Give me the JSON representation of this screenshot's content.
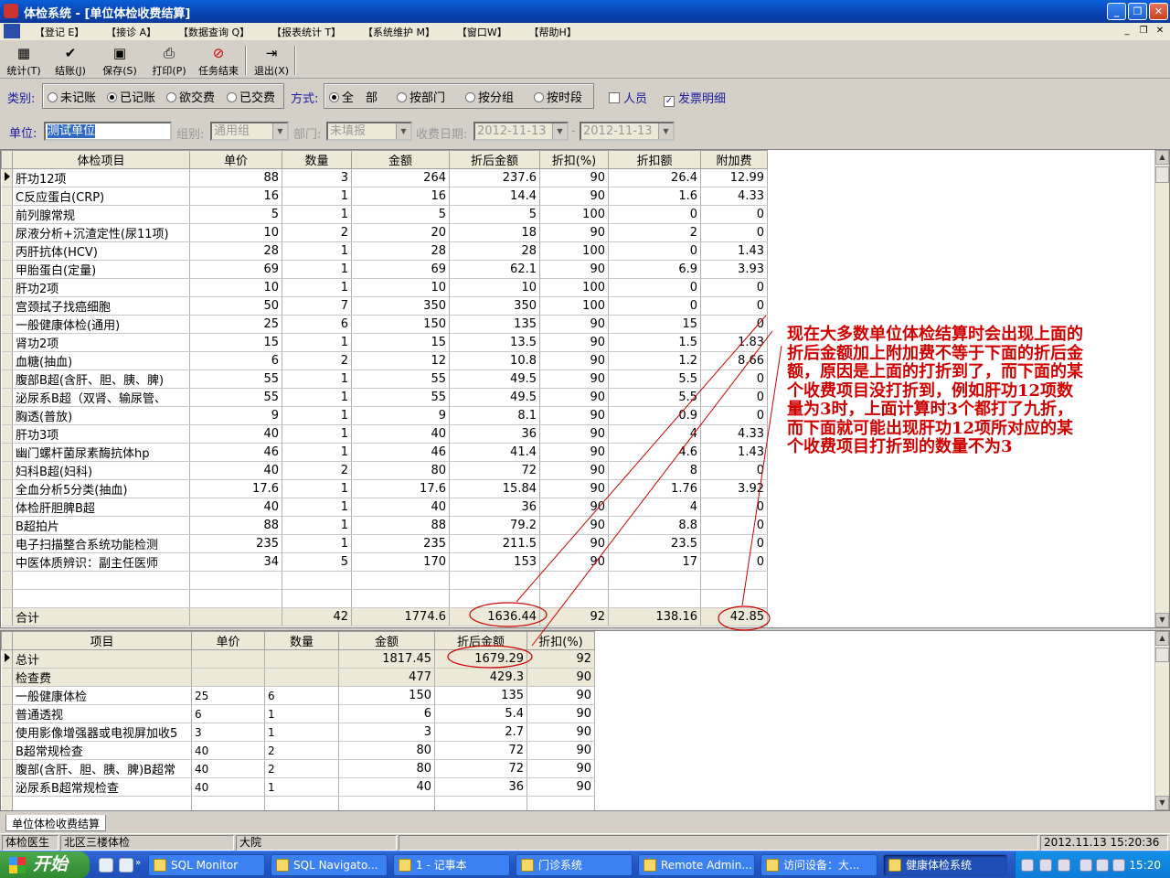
{
  "window": {
    "title": "体检系统 - [单位体检收费结算]"
  },
  "menu": [
    "【登记 E】",
    "【接诊 A】",
    "【数据查询 Q】",
    "【报表统计 T】",
    "【系统维护 M】",
    "【窗口W】",
    "【帮助H】"
  ],
  "toolbar": [
    {
      "label": "统计(T)",
      "icon": "stats-icon"
    },
    {
      "label": "结账(J)",
      "icon": "checkout-icon"
    },
    {
      "label": "保存(S)",
      "icon": "save-icon"
    },
    {
      "label": "打印(P)",
      "icon": "print-icon"
    },
    {
      "label": "任务结束",
      "icon": "stop-icon"
    },
    {
      "label": "退出(X)",
      "icon": "exit-icon"
    }
  ],
  "filters": {
    "category_label": "类别:",
    "categories": [
      {
        "label": "未记账",
        "checked": false
      },
      {
        "label": "已记账",
        "checked": true
      },
      {
        "label": "欲交费",
        "checked": false
      },
      {
        "label": "已交费",
        "checked": false
      }
    ],
    "mode_label": "方式:",
    "modes": [
      {
        "label": "全　部",
        "checked": true
      },
      {
        "label": "按部门",
        "checked": false
      },
      {
        "label": "按分组",
        "checked": false
      },
      {
        "label": "按时段",
        "checked": false
      }
    ],
    "person": {
      "label": "人员",
      "checked": false
    },
    "invoice": {
      "label": "发票明细",
      "checked": true
    }
  },
  "unitbar": {
    "unit_label": "单位:",
    "unit_value": "测试单位",
    "group_label": "组别:",
    "group_value": "通用组",
    "dept_label": "部门:",
    "dept_value": "未填报",
    "date_label": "收费日期:",
    "date_from": "2012-11-13",
    "date_to": "2012-11-13",
    "date_sep": "-"
  },
  "grid1": {
    "headers": [
      "体检项目",
      "单价",
      "数量",
      "金额",
      "折后金额",
      "折扣(%)",
      "折扣额",
      "附加费"
    ],
    "rows": [
      [
        "肝功12项",
        "88",
        "3",
        "264",
        "237.6",
        "90",
        "26.4",
        "12.99"
      ],
      [
        "C反应蛋白(CRP)",
        "16",
        "1",
        "16",
        "14.4",
        "90",
        "1.6",
        "4.33"
      ],
      [
        "前列腺常规",
        "5",
        "1",
        "5",
        "5",
        "100",
        "0",
        "0"
      ],
      [
        "尿液分析+沉渣定性(尿11项)",
        "10",
        "2",
        "20",
        "18",
        "90",
        "2",
        "0"
      ],
      [
        "丙肝抗体(HCV)",
        "28",
        "1",
        "28",
        "28",
        "100",
        "0",
        "1.43"
      ],
      [
        "甲胎蛋白(定量)",
        "69",
        "1",
        "69",
        "62.1",
        "90",
        "6.9",
        "3.93"
      ],
      [
        "肝功2项",
        "10",
        "1",
        "10",
        "10",
        "100",
        "0",
        "0"
      ],
      [
        "宫颈拭子找癌细胞",
        "50",
        "7",
        "350",
        "350",
        "100",
        "0",
        "0"
      ],
      [
        "一般健康体检(通用)",
        "25",
        "6",
        "150",
        "135",
        "90",
        "15",
        "0"
      ],
      [
        "肾功2项",
        "15",
        "1",
        "15",
        "13.5",
        "90",
        "1.5",
        "1.83"
      ],
      [
        "血糖(抽血)",
        "6",
        "2",
        "12",
        "10.8",
        "90",
        "1.2",
        "8.66"
      ],
      [
        "腹部B超(含肝、胆、胰、脾)",
        "55",
        "1",
        "55",
        "49.5",
        "90",
        "5.5",
        "0"
      ],
      [
        "泌尿系B超（双肾、输尿管、",
        "55",
        "1",
        "55",
        "49.5",
        "90",
        "5.5",
        "0"
      ],
      [
        "胸透(普放)",
        "9",
        "1",
        "9",
        "8.1",
        "90",
        "0.9",
        "0"
      ],
      [
        "肝功3项",
        "40",
        "1",
        "40",
        "36",
        "90",
        "4",
        "4.33"
      ],
      [
        "幽门螺杆菌尿素酶抗体hp",
        "46",
        "1",
        "46",
        "41.4",
        "90",
        "4.6",
        "1.43"
      ],
      [
        "妇科B超(妇科)",
        "40",
        "2",
        "80",
        "72",
        "90",
        "8",
        "0"
      ],
      [
        "全血分析5分类(抽血)",
        "17.6",
        "1",
        "17.6",
        "15.84",
        "90",
        "1.76",
        "3.92"
      ],
      [
        "体检肝胆脾B超",
        "40",
        "1",
        "40",
        "36",
        "90",
        "4",
        "0"
      ],
      [
        "B超拍片",
        "88",
        "1",
        "88",
        "79.2",
        "90",
        "8.8",
        "0"
      ],
      [
        "电子扫描整合系统功能检测",
        "235",
        "1",
        "235",
        "211.5",
        "90",
        "23.5",
        "0"
      ],
      [
        "中医体质辨识：副主任医师",
        "34",
        "5",
        "170",
        "153",
        "90",
        "17",
        "0"
      ]
    ],
    "total": [
      "合计",
      "",
      "42",
      "1774.6",
      "1636.44",
      "92",
      "138.16",
      "42.85"
    ]
  },
  "grid2": {
    "headers": [
      "项目",
      "单价",
      "数量",
      "金额",
      "折后金额",
      "折扣(%)"
    ],
    "rows": [
      {
        "c": [
          "总计",
          "",
          "",
          "1817.45",
          "1679.29",
          "92"
        ],
        "shade": true
      },
      {
        "c": [
          "检查费",
          "",
          "",
          "477",
          "429.3",
          "90"
        ],
        "shade": true
      },
      {
        "c": [
          "一般健康体检",
          "25",
          "6",
          "150",
          "135",
          "90"
        ],
        "shade": false
      },
      {
        "c": [
          "普通透视",
          "6",
          "1",
          "6",
          "5.4",
          "90"
        ],
        "shade": false
      },
      {
        "c": [
          "使用影像增强器或电视屏加收5",
          "3",
          "1",
          "3",
          "2.7",
          "90"
        ],
        "shade": false
      },
      {
        "c": [
          "B超常规检查",
          "40",
          "2",
          "80",
          "72",
          "90"
        ],
        "shade": false
      },
      {
        "c": [
          "腹部(含肝、胆、胰、脾)B超常",
          "40",
          "2",
          "80",
          "72",
          "90"
        ],
        "shade": false
      },
      {
        "c": [
          "泌尿系B超常规检查",
          "40",
          "1",
          "40",
          "36",
          "90"
        ],
        "shade": false
      }
    ]
  },
  "annotation": "现在大多数单位体检结算时会出现上面的折后金额加上附加费不等于下面的折后金额，原因是上面的打折到了，而下面的某个收费项目没打折到，例如肝功12项数量为3时，上面计算时3个都打了九折，而下面就可能出现肝功12项所对应的某个收费项目打折到的数量不为3",
  "tab": "单位体检收费结算",
  "status": {
    "user": "体检医生",
    "location": "北区三楼体检",
    "site": "大院",
    "datetime": "2012.11.13 15:20:36"
  },
  "taskbar": {
    "start": "开始",
    "tasks": [
      "SQL Monitor",
      "SQL Navigato...",
      "1 - 记事本",
      "门诊系统",
      "Remote Admin...",
      "访问设备：大...",
      "健康体检系统"
    ],
    "clock": "15:20"
  },
  "colors": {
    "annotation": "#d00000",
    "title_bar": "#0a5fd8",
    "label_blue": "#1a1aa0"
  }
}
